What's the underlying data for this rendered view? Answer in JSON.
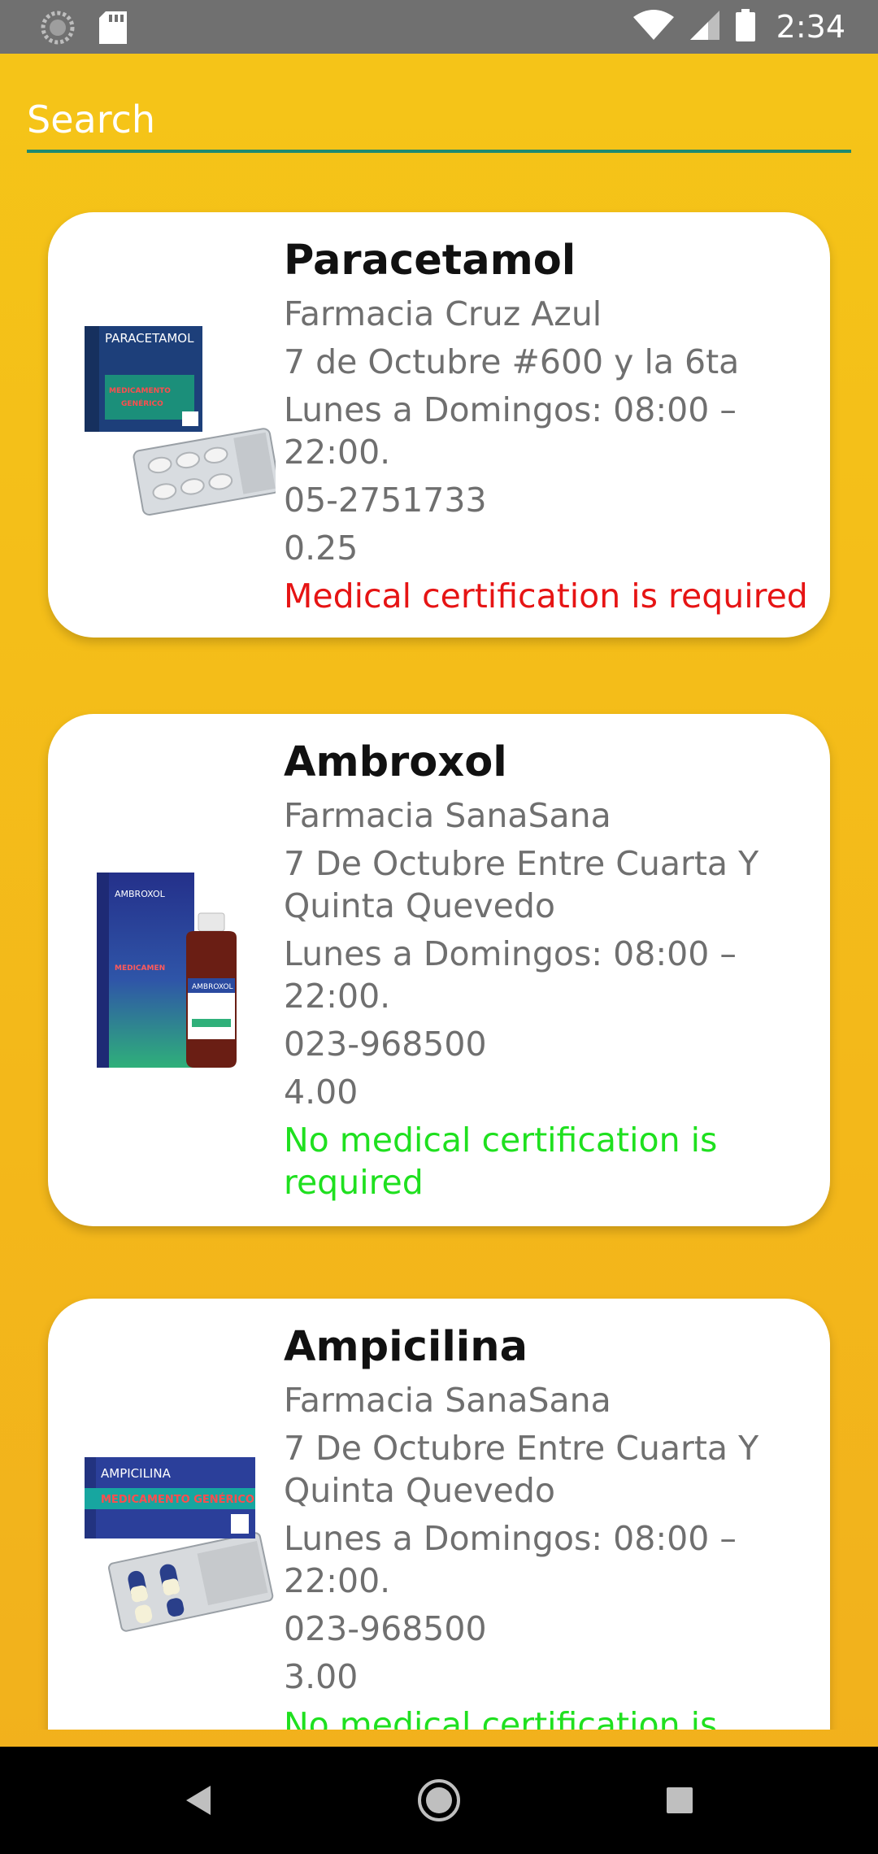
{
  "status_bar": {
    "time": "2:34",
    "left_icons": [
      "loading-icon",
      "sd-card-icon"
    ],
    "right_icons": [
      "wifi-icon",
      "signal-icon",
      "battery-icon"
    ]
  },
  "search": {
    "placeholder": "Search",
    "value": ""
  },
  "colors": {
    "background": "#f5c518",
    "certification_required": "#e61414",
    "no_certification": "#1fe01f",
    "search_underline": "#1f8a70"
  },
  "medicines": [
    {
      "name": "Paracetamol",
      "pharmacy": "Farmacia Cruz Azul",
      "address": "7 de Octubre #600 y la 6ta",
      "hours": "Lunes a Domingos: 08:00 – 22:00.",
      "phone": "05-2751733",
      "price": "0.25",
      "certification": "Medical certification is required",
      "image_label_main": "PARACETAMOL",
      "image_label_sub": "MEDICAMENTO GENÉRICO"
    },
    {
      "name": "Ambroxol",
      "pharmacy": "Farmacia SanaSana",
      "address": "7 De Octubre Entre Cuarta Y Quinta Quevedo",
      "hours": "Lunes a Domingos: 08:00 – 22:00.",
      "phone": "023-968500",
      "price": "4.00",
      "certification": "No medical certification is required",
      "image_label_main": "AMBROXOL",
      "image_label_sub": "MEDICAMENTO GENÉRICO"
    },
    {
      "name": "Ampicilina",
      "pharmacy": "Farmacia SanaSana",
      "address": "7 De Octubre Entre Cuarta Y Quinta Quevedo",
      "hours": "Lunes a Domingos: 08:00 – 22:00.",
      "phone": "023-968500",
      "price": "3.00",
      "certification": "No medical certification is required",
      "image_label_main": "AMPICILINA",
      "image_label_sub": "MEDICAMENTO GENÉRICO"
    }
  ],
  "nav_bar": {
    "buttons": [
      "back-icon",
      "home-icon",
      "recents-icon"
    ]
  }
}
